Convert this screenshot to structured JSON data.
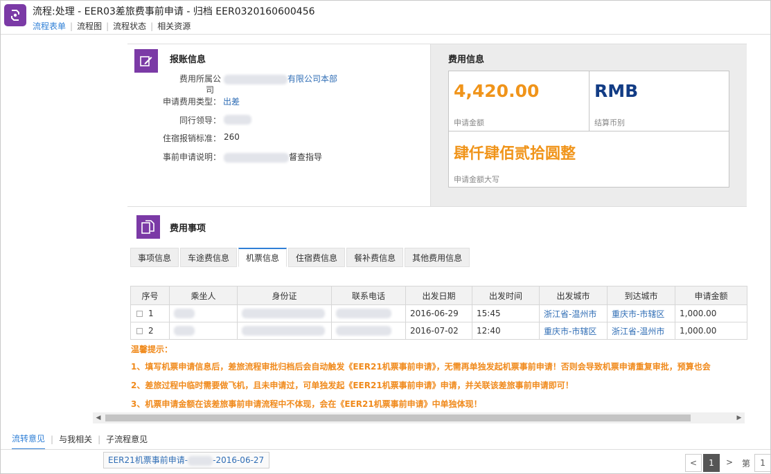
{
  "header": {
    "title": "流程:处理 - EER03差旅费事前申请 - 归档 EER0320160600456",
    "tabs": [
      "流程表单",
      "流程图",
      "流程状态",
      "相关资源"
    ]
  },
  "report": {
    "section_title": "报账信息",
    "fields": {
      "company_label": "费用所属公",
      "company_label2": "司",
      "company_value": "有限公司本部",
      "type_label": "申请费用类型：",
      "type_value": "出差",
      "leader_label": "同行领导：",
      "standard_label": "住宿报销标准：",
      "standard_value": "260",
      "desc_label": "事前申请说明：",
      "desc_value": "督查指导"
    }
  },
  "fee_info": {
    "section_title": "费用信息",
    "amount": "4,420.00",
    "amount_label": "申请金额",
    "currency": "RMB",
    "currency_label": "结算币别",
    "amount_cn": "肆仟肆佰贰拾圆整",
    "amount_cn_label": "申请金额大写"
  },
  "fee_items": {
    "section_title": "费用事项",
    "tabs": [
      "事项信息",
      "车途费信息",
      "机票信息",
      "住宿费信息",
      "餐补费信息",
      "其他费用信息"
    ],
    "active_tab": "机票信息",
    "columns": [
      "序号",
      "乘坐人",
      "身份证",
      "联系电话",
      "出发日期",
      "出发时间",
      "出发城市",
      "到达城市",
      "申请金额"
    ],
    "rows": [
      {
        "no": "1",
        "date": "2016-06-29",
        "time": "15:45",
        "from": "浙江省-温州市",
        "to": "重庆市-市辖区",
        "amount": "1,000.00"
      },
      {
        "no": "2",
        "date": "2016-07-02",
        "time": "12:40",
        "from": "重庆市-市辖区",
        "to": "浙江省-温州市",
        "amount": "1,000.00"
      }
    ],
    "tips_title": "温馨提示：",
    "tips": [
      "1、填写机票申请信息后，差旅流程审批归档后会自动触发《EER21机票事前申请》，无需再单独发起机票事前申请！否则会导致机票申请重复审批，预算也会",
      "2、差旅过程中临时需要做飞机，且未申请过，可单独发起《EER21机票事前申请》申请，并关联该差旅事前申请即可！",
      "3、机票申请金额在该差旅事前申请流程中不体现，会在《EER21机票事前申请》中单独体现！"
    ]
  },
  "bottom": {
    "tabs": [
      "流转意见",
      "与我相关",
      "子流程意见"
    ],
    "item_prefix": "EER21机票事前申请-",
    "item_suffix": "-2016-06-27",
    "pager": {
      "current": "1",
      "next": ">",
      "prev": "<",
      "page_label": "第",
      "next_page": "1"
    }
  },
  "colors": {
    "accent": "#2f7fd6",
    "purple": "#7b3aa6",
    "orange": "#f0941a",
    "navy": "#123c85"
  }
}
